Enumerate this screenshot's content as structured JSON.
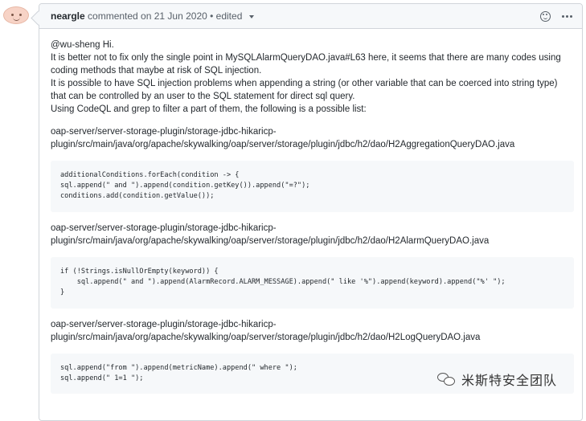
{
  "comment": {
    "author": "neargle",
    "meta": "commented on 21 Jun 2020 • edited",
    "header_icons": [
      "smiley-icon",
      "kebab-menu-icon"
    ],
    "paragraphs": [
      "@wu-sheng Hi.",
      "It is better not to fix only the single point in MySQLAlarmQueryDAO.java#L63 here, it seems that there are many codes using coding methods that maybe at risk of SQL injection.",
      "It is possible to have SQL injection problems when appending a string (or other variable that can be coerced into string type) that can be controlled by an user to the SQL statement for direct sql query.",
      "Using CodeQL and grep to filter a part of them, the following is a possible list:"
    ],
    "blocks": [
      {
        "path_line1": "oap-server/server-storage-plugin/storage-jdbc-hikaricp-",
        "path_line2": "plugin/src/main/java/org/apache/skywalking/oap/server/storage/plugin/jdbc/h2/dao/H2AggregationQueryDAO.java",
        "code": "additionalConditions.forEach(condition -> {\nsql.append(\" and \").append(condition.getKey()).append(\"=?\");\nconditions.add(condition.getValue());"
      },
      {
        "path_line1": "oap-server/server-storage-plugin/storage-jdbc-hikaricp-",
        "path_line2": "plugin/src/main/java/org/apache/skywalking/oap/server/storage/plugin/jdbc/h2/dao/H2AlarmQueryDAO.java",
        "code": "if (!Strings.isNullOrEmpty(keyword)) {\n    sql.append(\" and \").append(AlarmRecord.ALARM_MESSAGE).append(\" like '%\").append(keyword).append(\"%' \");\n}"
      },
      {
        "path_line1": "oap-server/server-storage-plugin/storage-jdbc-hikaricp-",
        "path_line2": "plugin/src/main/java/org/apache/skywalking/oap/server/storage/plugin/jdbc/h2/dao/H2LogQueryDAO.java",
        "code": "sql.append(\"from \").append(metricName).append(\" where \");\nsql.append(\" 1=1 \");"
      }
    ]
  },
  "watermark": {
    "text": "米斯特安全团队",
    "icon": "wechat-icon"
  }
}
